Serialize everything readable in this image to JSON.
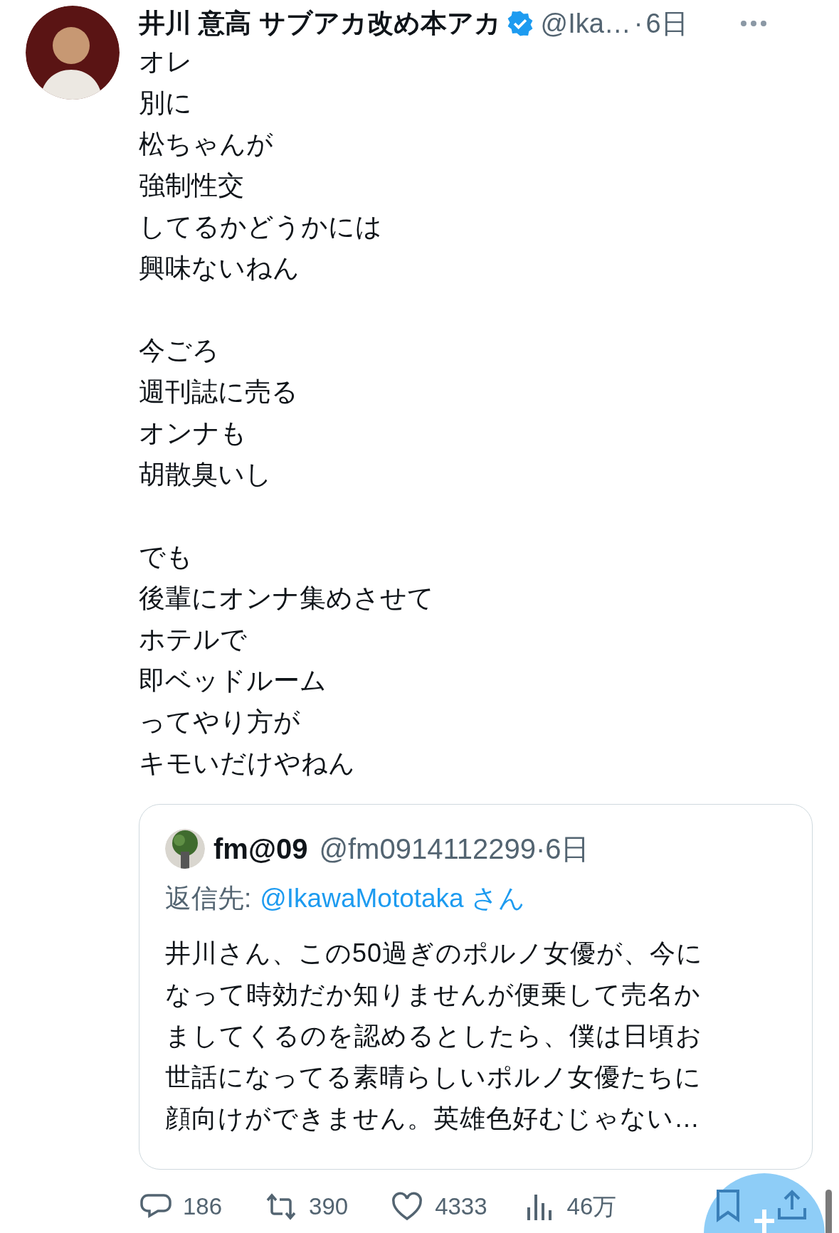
{
  "author": {
    "name": "井川 意高 サブアカ改め本アカ",
    "verified": true,
    "handle": "@Ika…",
    "separator": "·",
    "time": "6日"
  },
  "body": [
    [
      "オレ",
      "別に",
      "松ちゃんが",
      "強制性交",
      "してるかどうかには",
      "興味ないねん"
    ],
    [
      "今ごろ",
      "週刊誌に売る",
      "オンナも",
      "胡散臭いし"
    ],
    [
      "でも",
      "後輩にオンナ集めさせて",
      "ホテルで",
      "即ベッドルーム",
      "ってやり方が",
      "キモいだけやねん"
    ]
  ],
  "quote": {
    "name": "fm@09",
    "handle": "@fm0914112299",
    "separator": "·",
    "time": "6日",
    "reply_label": "返信先:",
    "reply_to": "@IkawaMototaka さん",
    "text_lines": [
      "井川さん、この50過ぎのポルノ女優が、今に",
      "なって時効だか知りませんが便乗して売名か",
      "ましてくるのを認めるとしたら、僕は日頃お",
      "世話になってる素晴らしいポルノ女優たちに",
      "顔向けができません。英雄色好むじゃない…"
    ]
  },
  "actions": [
    {
      "kind": "reply",
      "count": "186"
    },
    {
      "kind": "repost",
      "count": "390"
    },
    {
      "kind": "like",
      "count": "4333"
    },
    {
      "kind": "views",
      "count": "46万"
    },
    {
      "kind": "bookmark"
    },
    {
      "kind": "share"
    }
  ]
}
